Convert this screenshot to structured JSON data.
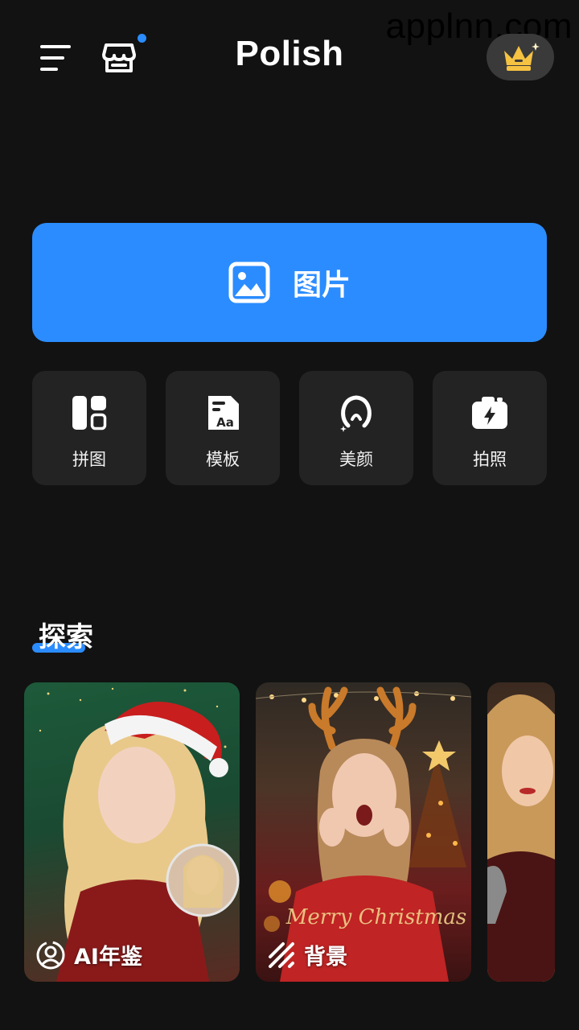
{
  "watermark": "applnn.com",
  "header": {
    "logo": "Polish"
  },
  "main_button": {
    "label": "图片"
  },
  "tools": [
    {
      "label": "拼图",
      "icon": "collage-icon"
    },
    {
      "label": "模板",
      "icon": "template-icon"
    },
    {
      "label": "美颜",
      "icon": "beauty-icon"
    },
    {
      "label": "拍照",
      "icon": "camera-icon"
    }
  ],
  "explore": {
    "title": "探索",
    "cards": [
      {
        "label": "AI年鉴",
        "icon": "ai-face-icon"
      },
      {
        "label": "背景",
        "icon": "background-stripes-icon"
      },
      {
        "label": "",
        "icon": ""
      }
    ]
  },
  "colors": {
    "background": "#121212",
    "accent": "#2b8cff",
    "tile": "#232323",
    "crown": "#f5c242"
  }
}
